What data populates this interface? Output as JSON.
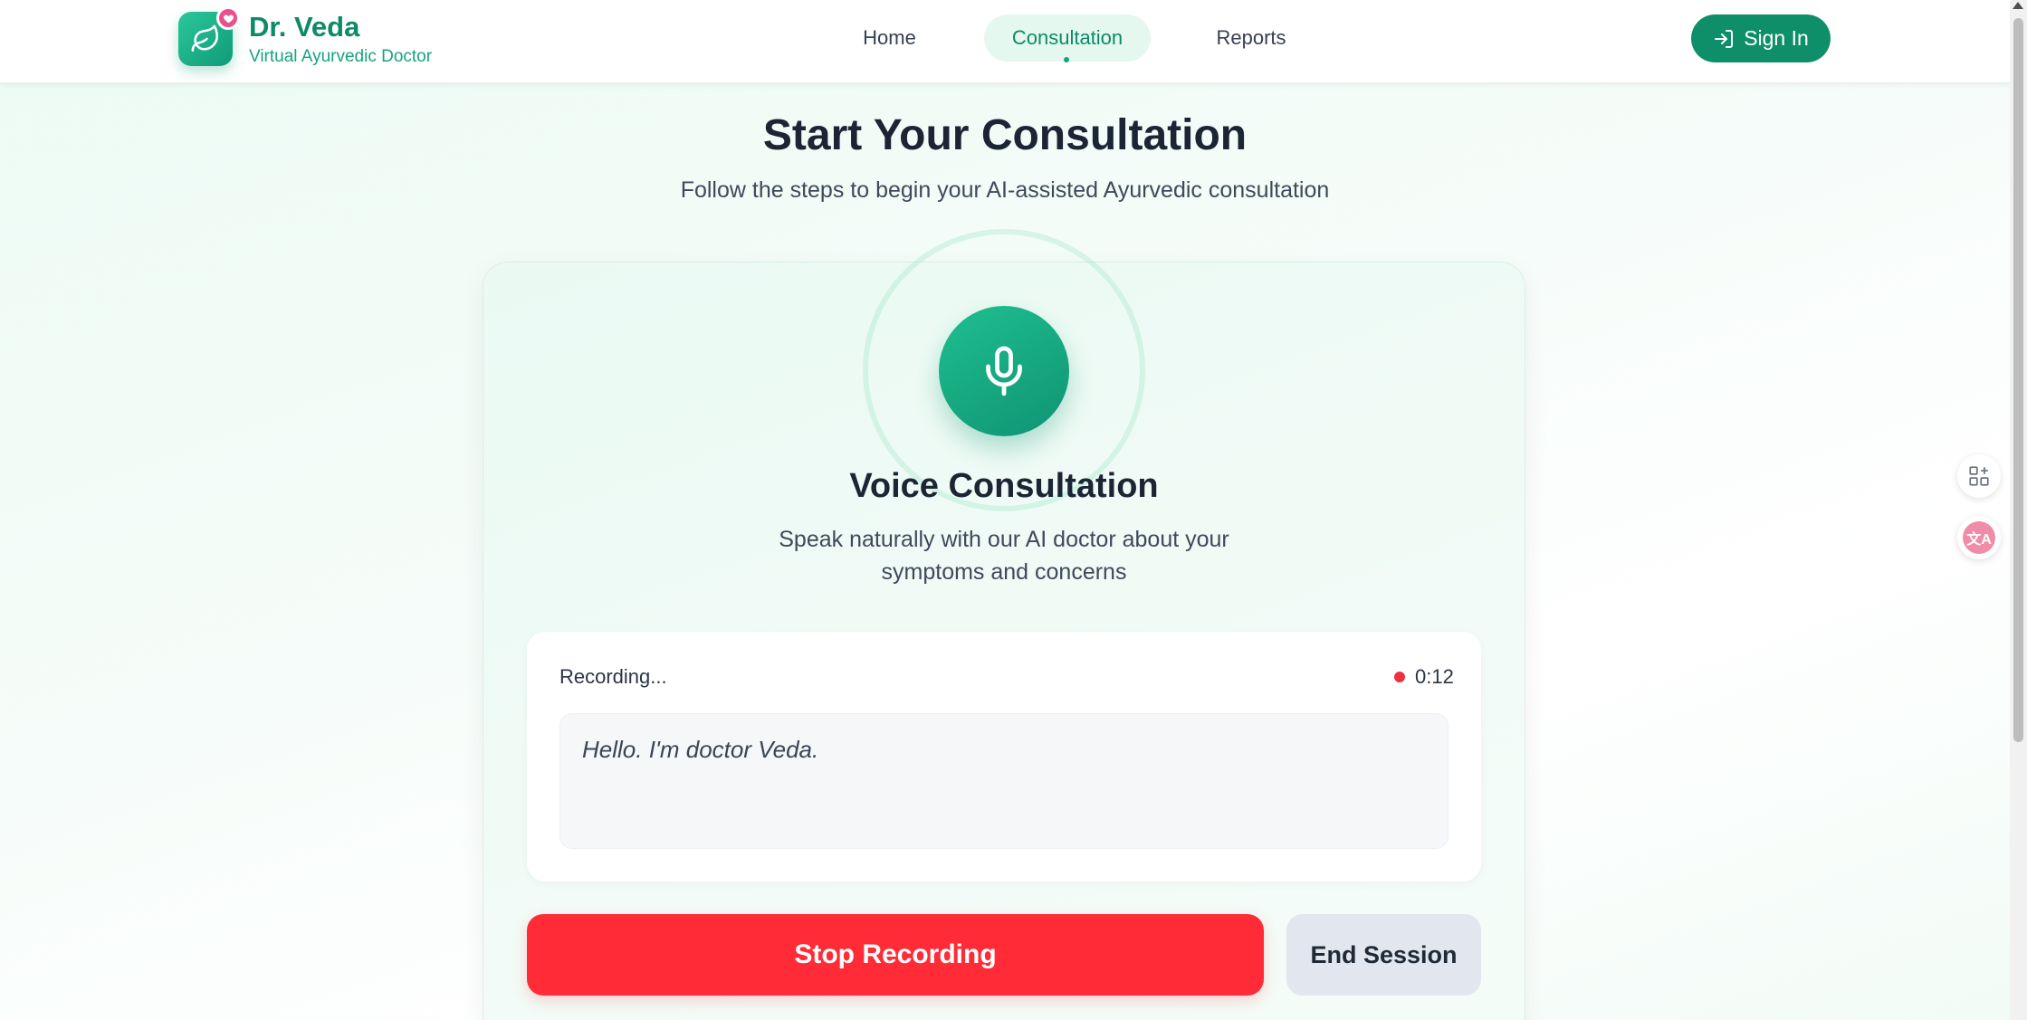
{
  "brand": {
    "name": "Dr. Veda",
    "tagline": "Virtual Ayurvedic Doctor",
    "logo_icon": "leaf-icon",
    "badge_icon": "heart-icon"
  },
  "nav": {
    "items": [
      {
        "label": "Home",
        "active": false
      },
      {
        "label": "Consultation",
        "active": true
      },
      {
        "label": "Reports",
        "active": false
      }
    ]
  },
  "signin": {
    "label": "Sign In",
    "icon": "login-arrow-icon"
  },
  "side_tools": {
    "apps_icon": "apps-add-icon",
    "translate_icon": "translate-icon",
    "translate_glyph": "文A"
  },
  "page": {
    "title": "Start Your Consultation",
    "subtitle": "Follow the steps to begin your AI-assisted Ayurvedic consultation"
  },
  "voice": {
    "icon": "microphone-icon",
    "title": "Voice Consultation",
    "description": "Speak naturally with our AI doctor about your symptoms and concerns"
  },
  "recording": {
    "status": "Recording...",
    "timer": "0:12",
    "transcript": "Hello. I'm doctor Veda."
  },
  "actions": {
    "stop_label": "Stop Recording",
    "end_label": "End Session"
  },
  "colors": {
    "brand_green": "#0f8f69",
    "accent_pink": "#ec4f8d",
    "stop_red": "#ff2b36",
    "recording_dot": "#ef3040"
  }
}
